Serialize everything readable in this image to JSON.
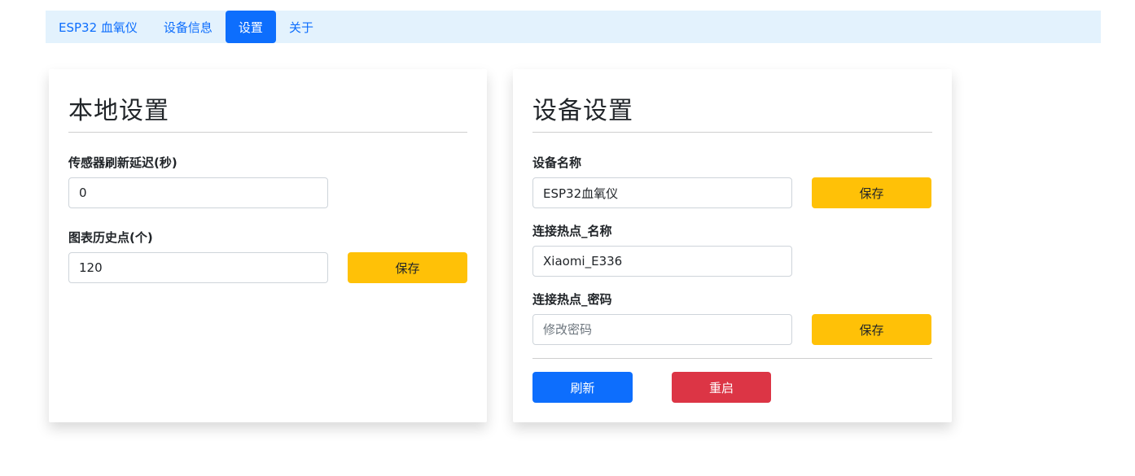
{
  "nav": {
    "brand": "ESP32 血氧仪",
    "items": [
      {
        "label": "设备信息"
      },
      {
        "label": "设置"
      },
      {
        "label": "关于"
      }
    ]
  },
  "local_settings": {
    "title": "本地设置",
    "sensor_delay_label": "传感器刷新延迟(秒)",
    "sensor_delay_value": "0",
    "history_points_label": "图表历史点(个)",
    "history_points_value": "120",
    "save_label": "保存"
  },
  "device_settings": {
    "title": "设备设置",
    "device_name_label": "设备名称",
    "device_name_value": "ESP32血氧仪",
    "device_name_save_label": "保存",
    "hotspot_name_label": "连接热点_名称",
    "hotspot_name_value": "Xiaomi_E336",
    "hotspot_password_label": "连接热点_密码",
    "hotspot_password_placeholder": "修改密码",
    "hotspot_save_label": "保存",
    "refresh_label": "刷新",
    "restart_label": "重启"
  },
  "colors": {
    "nav_bg": "#e3f2fd",
    "primary": "#0d6efd",
    "warning": "#ffc107",
    "danger": "#dc3545"
  }
}
